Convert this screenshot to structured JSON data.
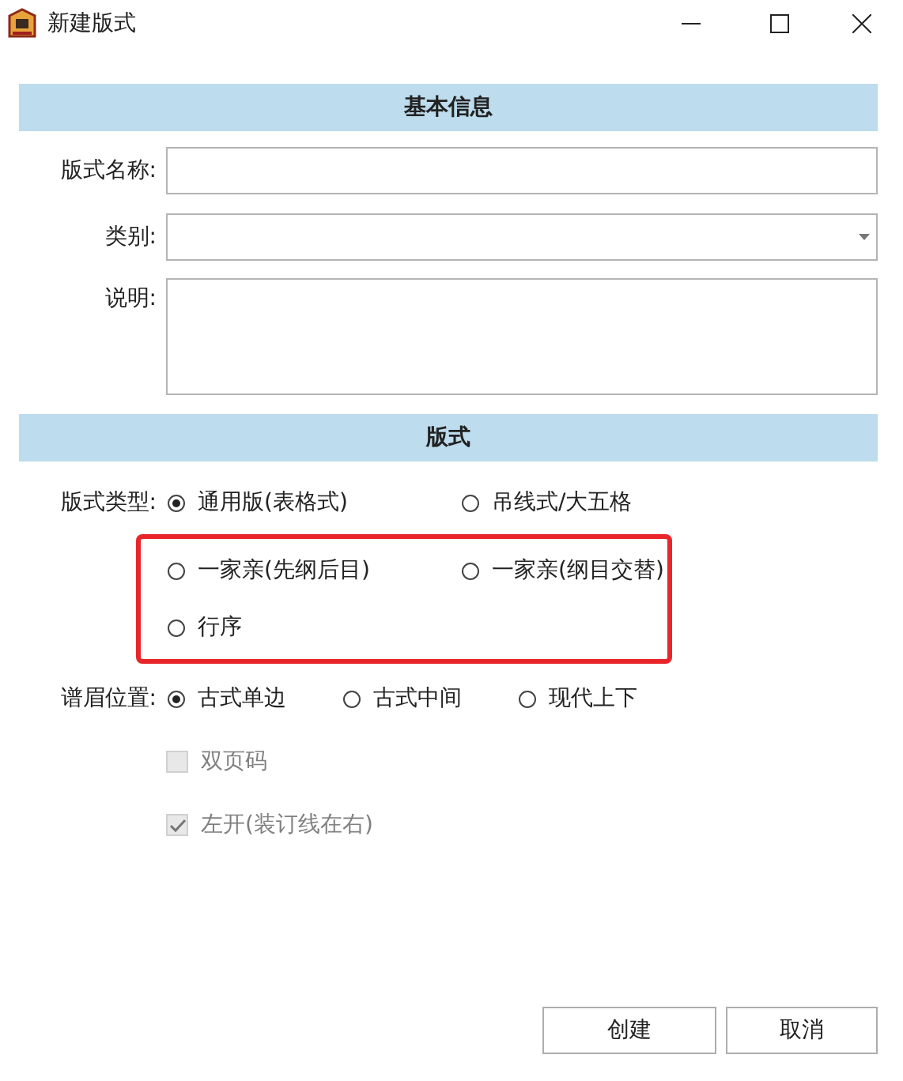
{
  "window": {
    "title": "新建版式"
  },
  "sections": [
    {
      "title": "基本信息"
    },
    {
      "title": "版式"
    }
  ],
  "fields": [
    {
      "kind": "text",
      "label": "版式名称:"
    },
    {
      "kind": "dropdown",
      "label": "类别:"
    },
    {
      "kind": "textarea",
      "label": "说明:"
    }
  ],
  "radio_groups": [
    {
      "label": "版式类型:",
      "rows": [
        {
          "highlighted": false,
          "options": [
            {
              "label": "通用版(表格式)",
              "selected": true
            },
            {
              "label": "吊线式/大五格",
              "selected": false
            }
          ]
        },
        {
          "highlighted": true,
          "options": [
            {
              "label": "一家亲(先纲后目)",
              "selected": false
            },
            {
              "label": "一家亲(纲目交替)",
              "selected": false
            }
          ]
        },
        {
          "highlighted": true,
          "options": [
            {
              "label": "行序",
              "selected": false
            }
          ]
        }
      ]
    },
    {
      "label": "谱眉位置:",
      "rows": [
        {
          "highlighted": false,
          "options": [
            {
              "label": "古式单边",
              "selected": true
            },
            {
              "label": "古式中间",
              "selected": false
            },
            {
              "label": "现代上下",
              "selected": false
            }
          ]
        }
      ]
    }
  ],
  "checkboxes": [
    {
      "label": "双页码",
      "checked": false,
      "disabled": true
    },
    {
      "label": "左开(装订线在右)",
      "checked": true,
      "disabled": true
    }
  ],
  "buttons": [
    "创建",
    "取消"
  ]
}
